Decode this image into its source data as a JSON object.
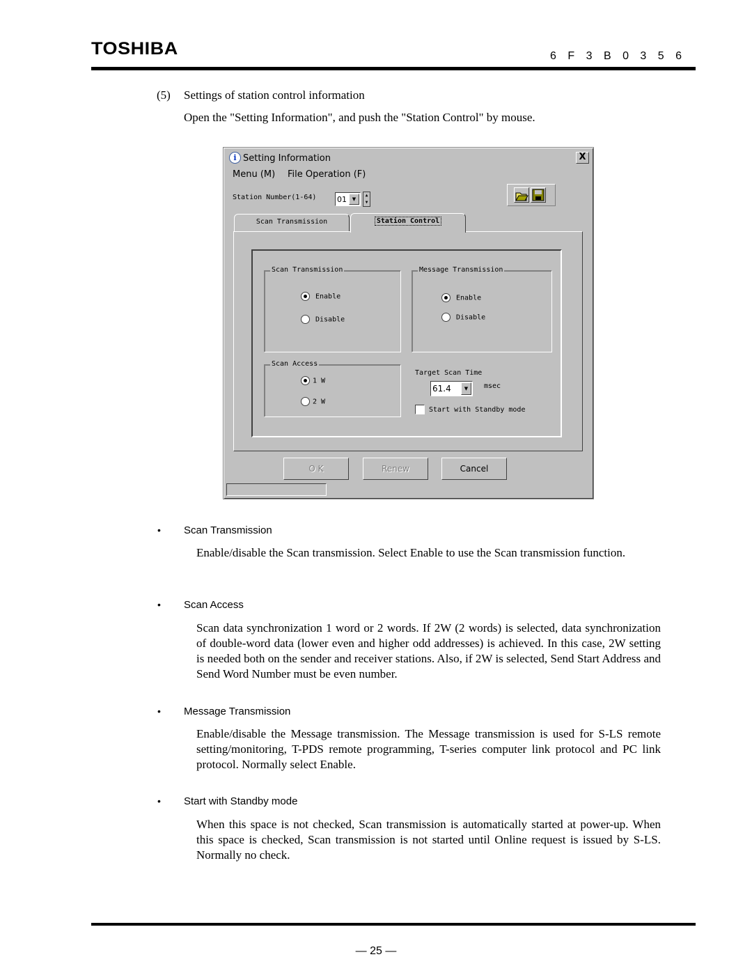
{
  "header": {
    "brand": "TOSHIBA",
    "doc_number": "6 F 3 B 0 3 5 6"
  },
  "section": {
    "number": "(5)",
    "title": "Settings of station control information",
    "intro": "Open the \"Setting Information\", and push the \"Station Control\" by mouse."
  },
  "dialog": {
    "title": "Setting Information",
    "info_icon": "i",
    "close_label": "X",
    "menu": [
      "Menu (M)",
      "File Operation (F)"
    ],
    "station_label": "Station Number(1-64)",
    "station_value": "01",
    "tabs": [
      {
        "label": "Scan Transmission",
        "active": false
      },
      {
        "label": "Station Control",
        "active": true
      }
    ],
    "scan_transmission": {
      "label": "Scan Transmission",
      "options": [
        "Enable",
        "Disable"
      ],
      "selected": "Enable"
    },
    "message_transmission": {
      "label": "Message Transmission",
      "options": [
        "Enable",
        "Disable"
      ],
      "selected": "Enable"
    },
    "scan_access": {
      "label": "Scan Access",
      "options": [
        "1 W",
        "2 W"
      ],
      "selected": "1 W"
    },
    "target_scan_time": {
      "label": "Target Scan Time",
      "value": "61.4",
      "unit": "msec"
    },
    "standby": {
      "label": "Start with Standby mode",
      "checked": false
    },
    "buttons": {
      "ok": "O K",
      "renew": "Renew",
      "cancel": "Cancel"
    }
  },
  "bullets": [
    {
      "heading": "Scan Transmission",
      "body": "Enable/disable the Scan transmission. Select Enable to use the Scan transmission function."
    },
    {
      "heading": "Scan Access",
      "body": "Scan data synchronization 1 word or 2 words. If 2W (2 words) is selected, data synchronization of double-word data (lower even and higher odd addresses) is achieved. In this case, 2W setting is needed both on the sender and receiver stations. Also, if 2W is selected, Send Start Address and Send Word Number must be even number."
    },
    {
      "heading": "Message Transmission",
      "body": "Enable/disable the Message transmission. The Message transmission is used for S-LS remote setting/monitoring, T-PDS remote programming, T-series computer link protocol and PC link protocol. Normally select Enable."
    },
    {
      "heading": "Start with Standby mode",
      "body": "When this space is not checked, Scan transmission is automatically started at power-up. When this space is checked, Scan transmission is not started until Online request is issued by S-LS. Normally no check."
    }
  ],
  "footer": {
    "page": "— 25 —"
  }
}
